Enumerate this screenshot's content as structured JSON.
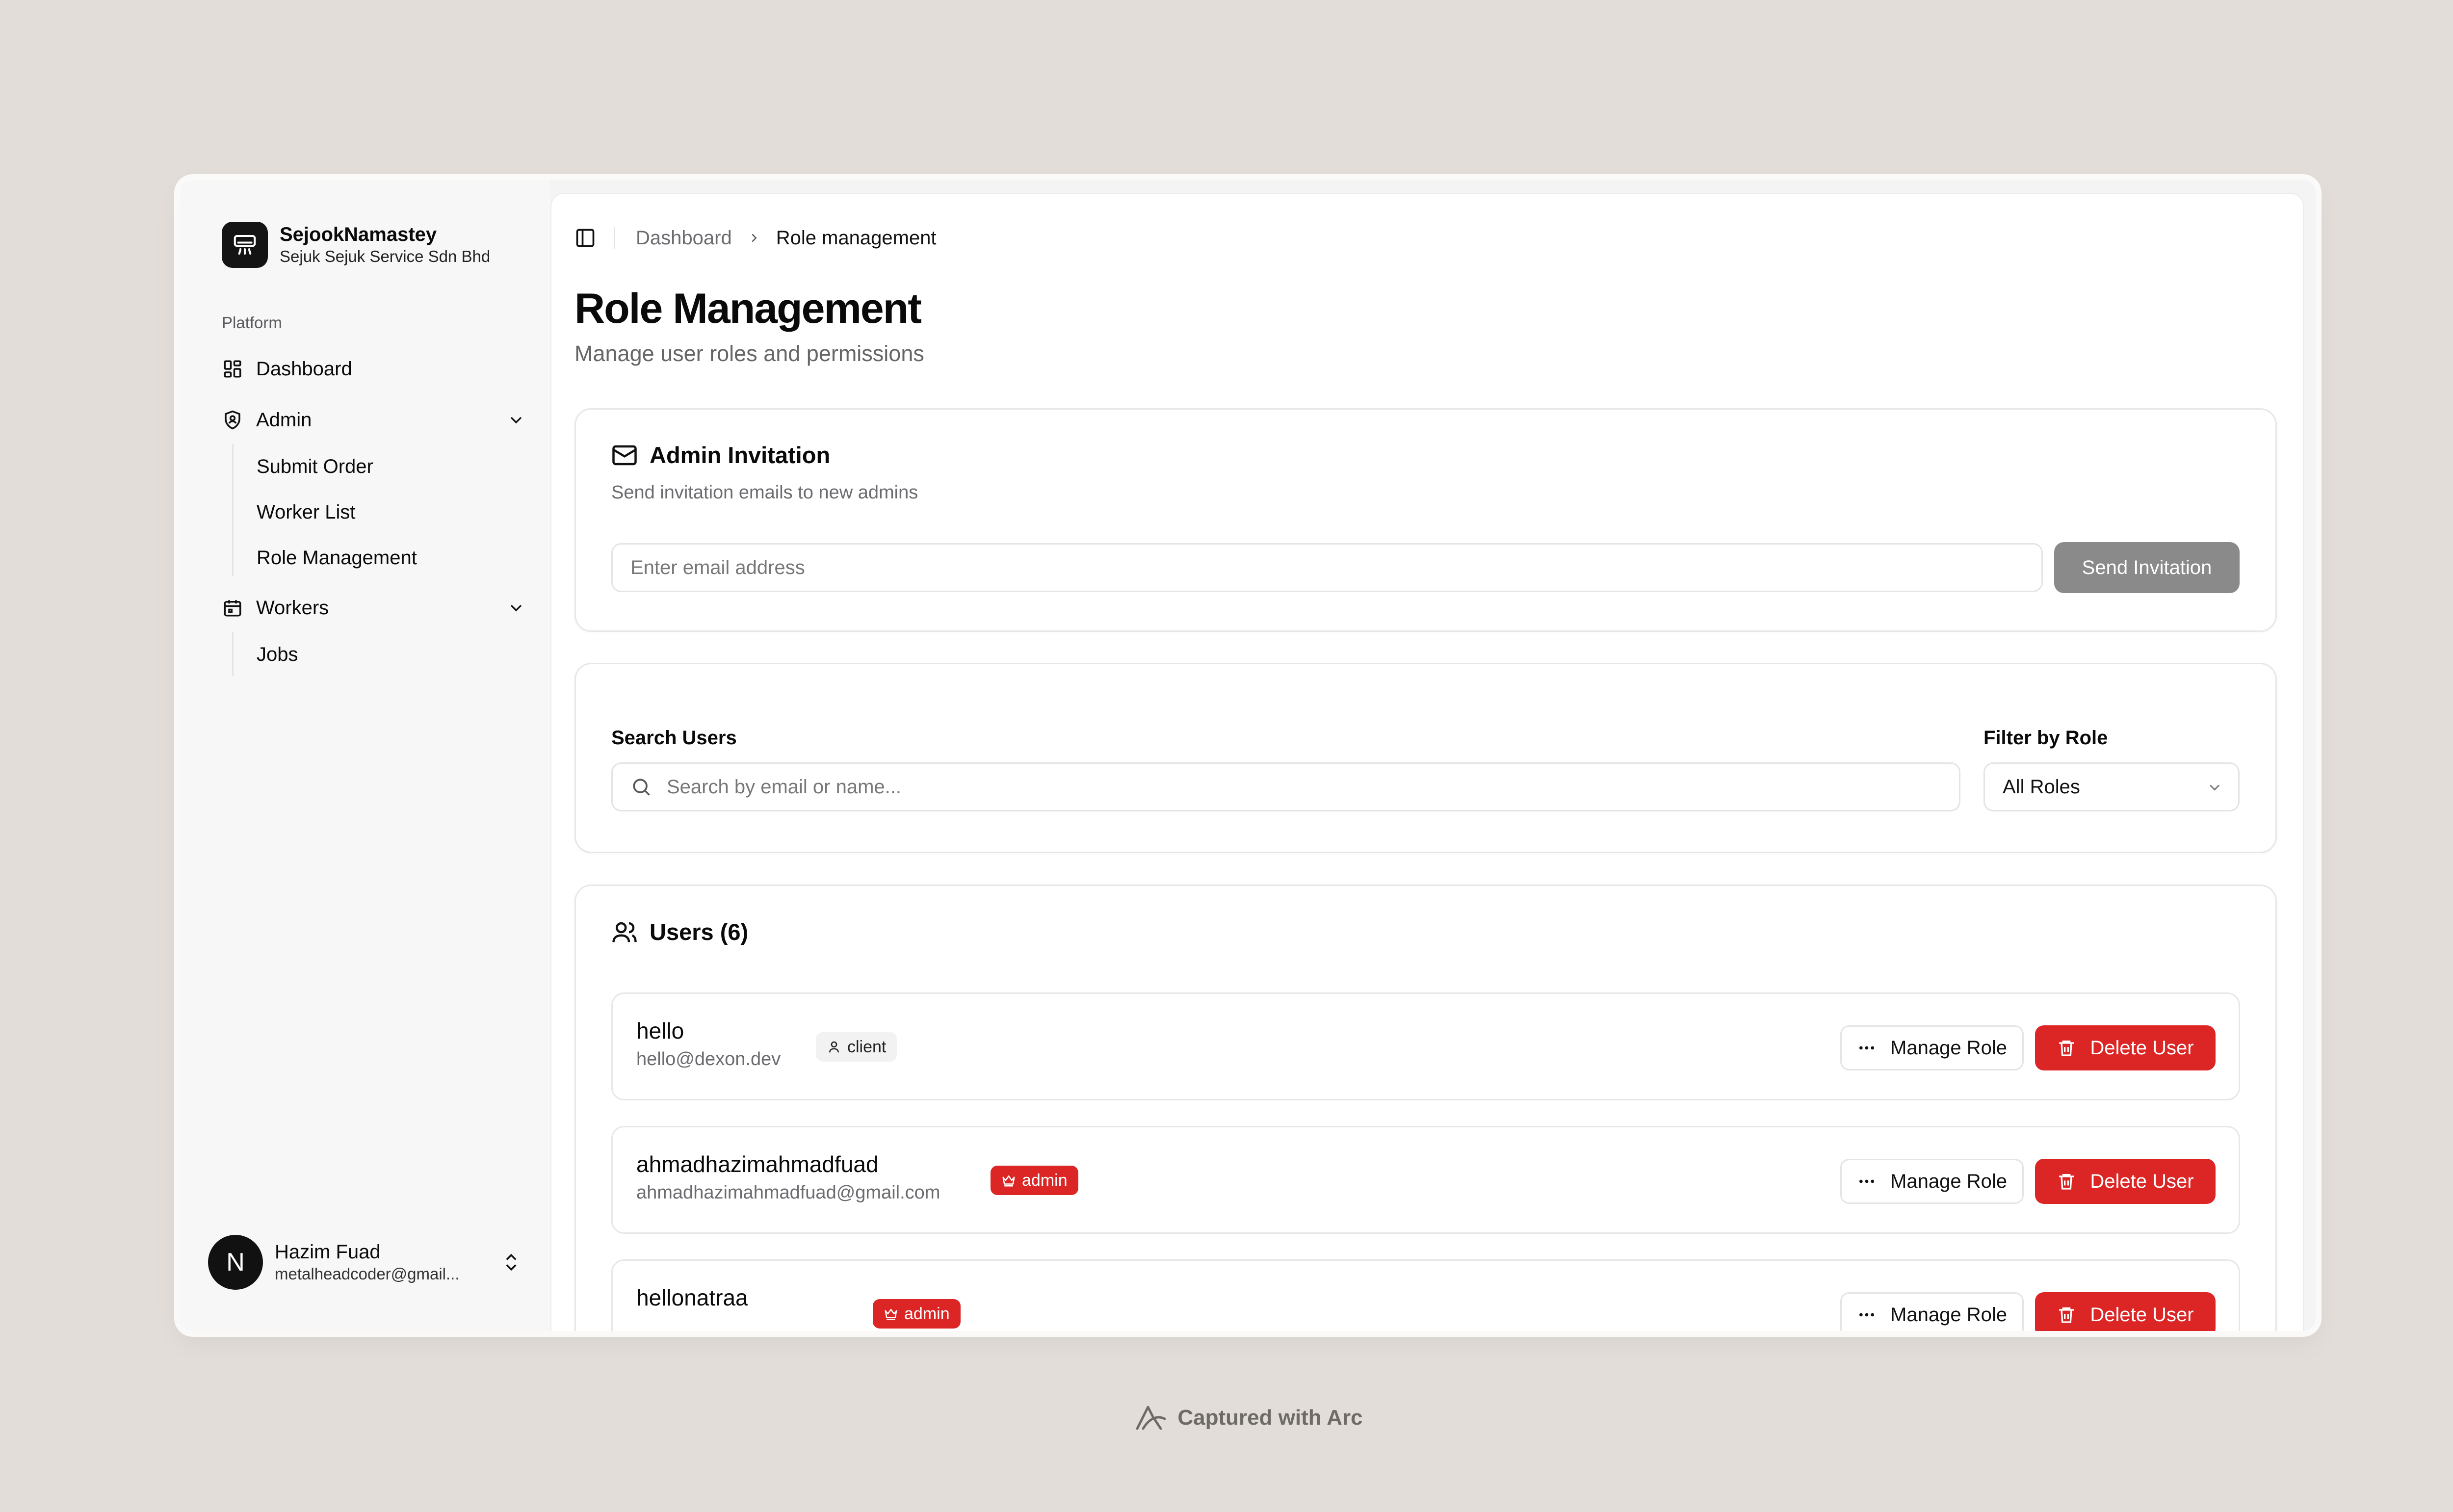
{
  "brand": {
    "name": "SejookNamastey",
    "company": "Sejuk Sejuk Service Sdn Bhd",
    "logo_icon": "brand-logo-icon"
  },
  "sidebar": {
    "group_label": "Platform",
    "dashboard": "Dashboard",
    "admin": "Admin",
    "admin_items": [
      "Submit Order",
      "Worker List",
      "Role Management"
    ],
    "workers": "Workers",
    "workers_items": [
      "Jobs"
    ]
  },
  "user": {
    "name": "Hazim Fuad",
    "email": "metalheadcoder@gmail...",
    "avatar_letter": "N"
  },
  "breadcrumb": {
    "root": "Dashboard",
    "current": "Role management"
  },
  "page": {
    "title": "Role Management",
    "subtitle": "Manage user roles and permissions"
  },
  "invitation": {
    "title": "Admin Invitation",
    "description": "Send invitation emails to new admins",
    "email_placeholder": "Enter email address",
    "send_label": "Send Invitation"
  },
  "filters": {
    "search_label": "Search Users",
    "search_placeholder": "Search by email or name...",
    "role_label": "Filter by Role",
    "role_value": "All Roles"
  },
  "users": {
    "title": "Users (6)",
    "manage_label": "Manage Role",
    "delete_label": "Delete User",
    "rows": [
      {
        "name": "hello",
        "email": "hello@dexon.dev",
        "role": "client"
      },
      {
        "name": "ahmadhazimahmadfuad",
        "email": "ahmadhazimahmadfuad@gmail.com",
        "role": "admin"
      },
      {
        "name": "hellonatraa",
        "email": "",
        "role": "admin"
      }
    ]
  },
  "footer": {
    "captured": "Captured with Arc"
  },
  "colors": {
    "danger": "#dc2626",
    "disabled_button": "#8a8a8a",
    "page_bg": "#e2ddd8"
  }
}
